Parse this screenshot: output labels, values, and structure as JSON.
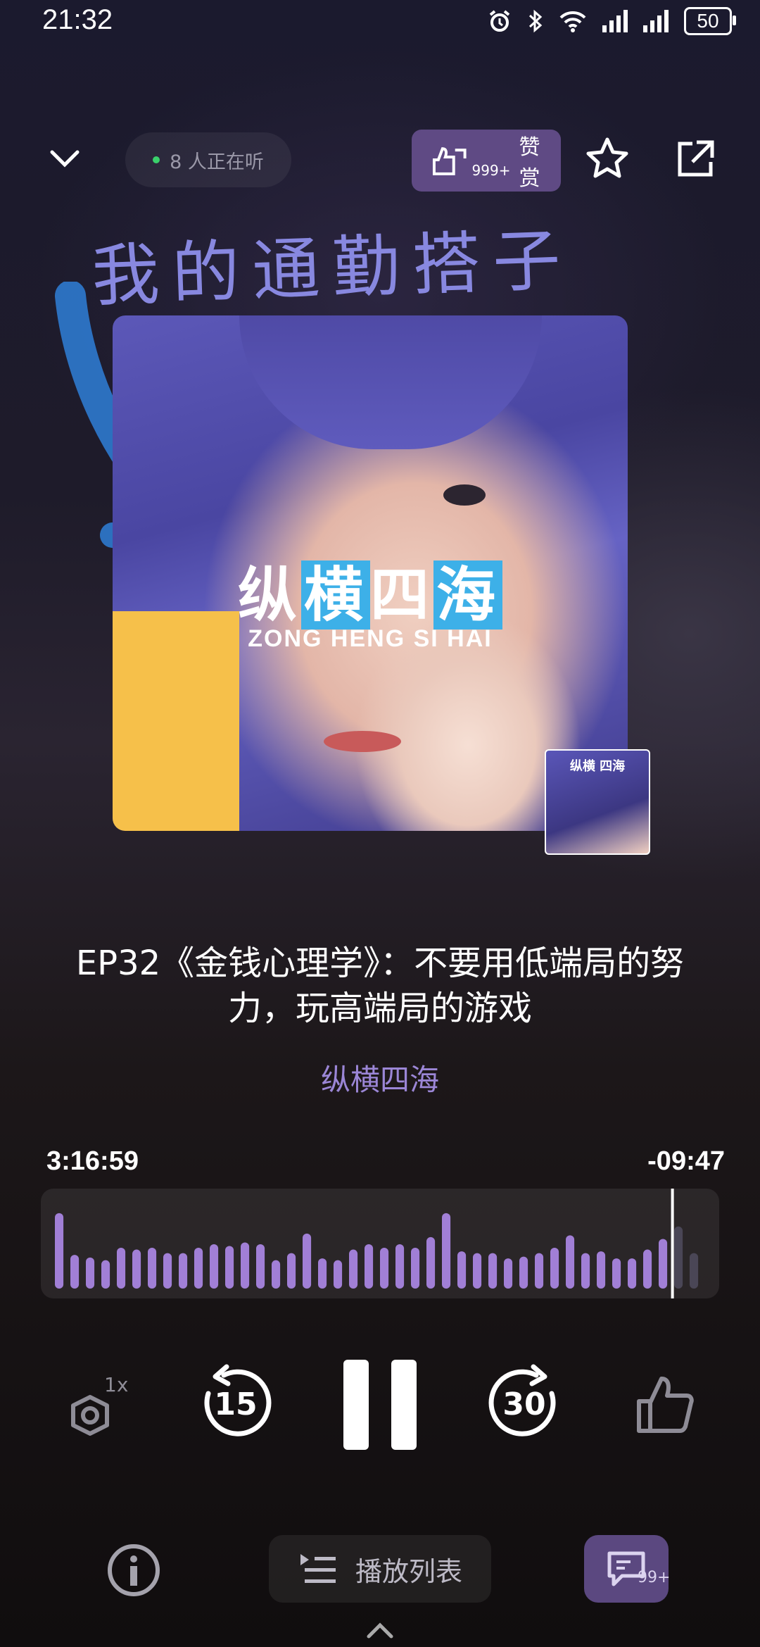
{
  "status_bar": {
    "time": "21:32",
    "battery": "50"
  },
  "header": {
    "listeners_text": "8 人正在听",
    "reward_label": "赞赏",
    "reward_count": "999+"
  },
  "overlay_text": "我的通勤搭子",
  "cover": {
    "title_parts": [
      "纵",
      "横",
      "四",
      "海"
    ],
    "subtitle": "ZONG HENG SI HAI",
    "thumb_label": "纵横 四海"
  },
  "episode": {
    "title": "EP32《金钱心理学》：不要用低端局的努力，玩高端局的游戏",
    "podcast": "纵横四海"
  },
  "player": {
    "elapsed": "3:16:59",
    "remaining": "-09:47",
    "progress": 0.95,
    "speed": "1x",
    "rewind_seconds": "15",
    "forward_seconds": "30",
    "waveform": [
      0.85,
      0.38,
      0.35,
      0.32,
      0.46,
      0.44,
      0.46,
      0.4,
      0.4,
      0.46,
      0.5,
      0.48,
      0.52,
      0.5,
      0.32,
      0.4,
      0.62,
      0.34,
      0.32,
      0.44,
      0.5,
      0.46,
      0.5,
      0.46,
      0.58,
      0.85,
      0.42,
      0.4,
      0.4,
      0.34,
      0.36,
      0.4,
      0.46,
      0.6,
      0.4,
      0.42,
      0.34,
      0.34,
      0.44,
      0.56,
      0.7,
      0.4
    ]
  },
  "bottom_bar": {
    "playlist_label": "播放列表",
    "comment_count": "99+"
  }
}
